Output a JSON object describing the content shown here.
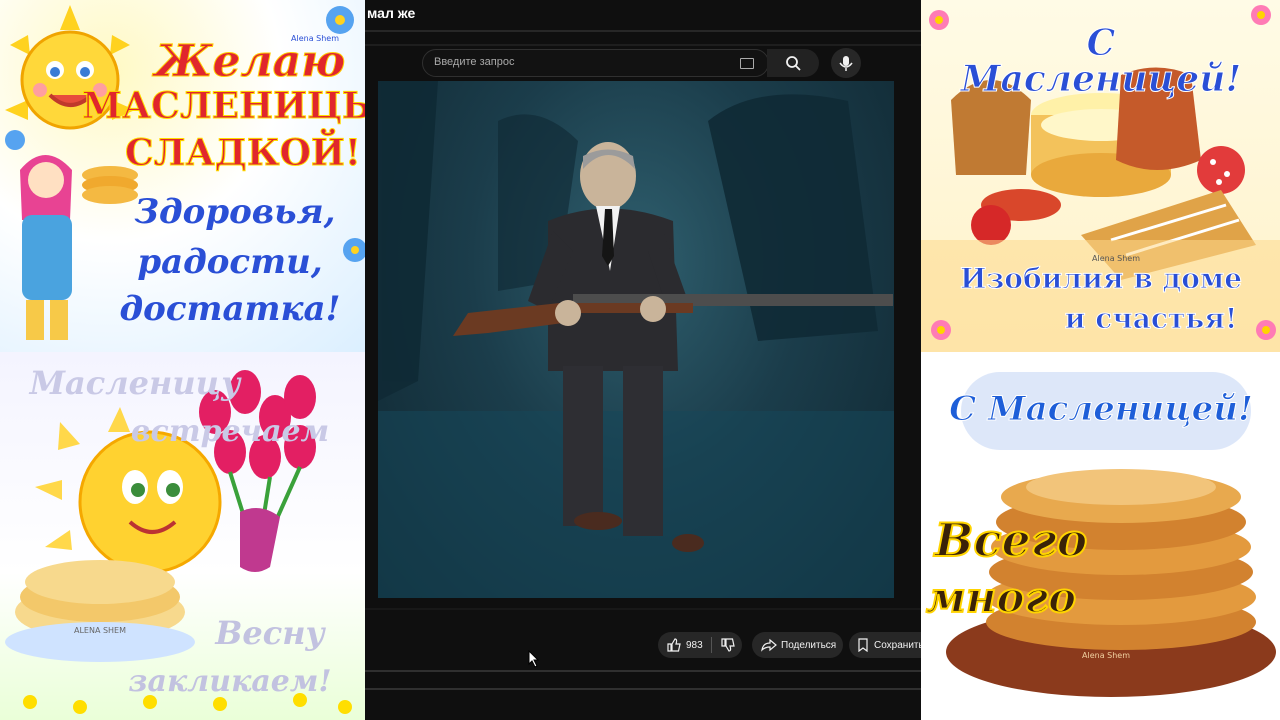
{
  "video_page": {
    "title": "мал же",
    "search": {
      "placeholder": "Введите запрос"
    },
    "likes": "983",
    "share_label": "Поделиться",
    "save_label": "Сохранить"
  },
  "cards": {
    "top_left": {
      "line1": "Желаю",
      "line2": "МАСЛЕНИЦЫ",
      "line3": "СЛАДКОЙ!",
      "line4": "Здоровья,",
      "line5": "радости,",
      "line6": "достатка!",
      "watermark": "Alena Shem"
    },
    "bottom_left": {
      "line1": "Масленицу",
      "line2": "встречаем",
      "line3": "Весну",
      "line4": "закликаем!",
      "watermark": "ALENA SHEM"
    },
    "top_right": {
      "line1": "С Масленицей!",
      "line2": "Изобилия в доме",
      "line3": "и счастья!",
      "watermark": "Alena Shem"
    },
    "bottom_right": {
      "line1": "С Масленицей!",
      "line2": "Всего",
      "line3": "много",
      "watermark": "Alena Shem"
    }
  },
  "colors": {
    "youtube_bg": "#0f0f0f",
    "pill_bg": "#272727",
    "text_primary": "#f1f1f1",
    "card_red": "#e0262d",
    "card_blue": "#2a4fd6",
    "card_yellow": "#ffcc00"
  },
  "icons": [
    "search-icon",
    "microphone-icon",
    "keyboard-icon",
    "like-icon",
    "dislike-icon",
    "share-icon",
    "save-icon",
    "cursor-icon"
  ]
}
